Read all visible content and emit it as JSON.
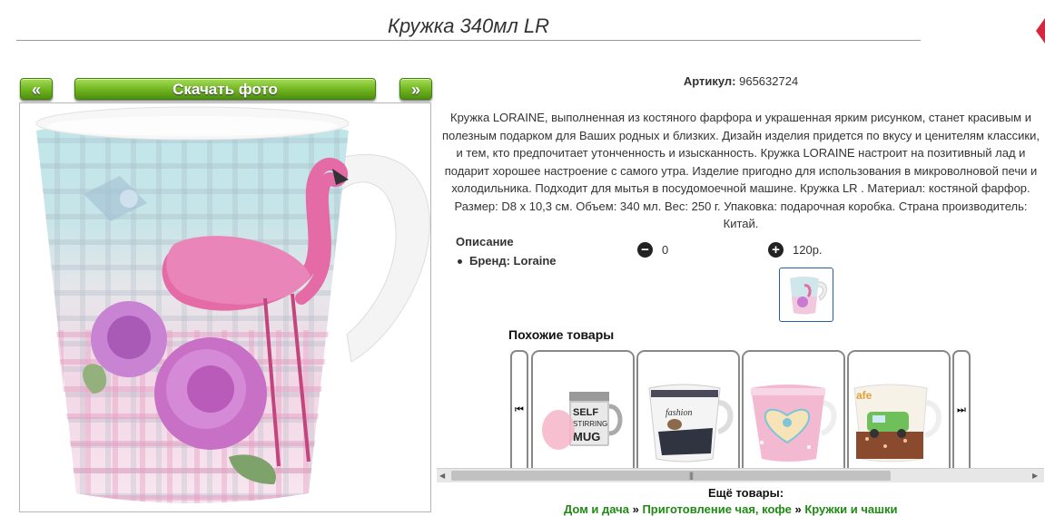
{
  "product": {
    "title": "Кружка 340мл LR",
    "sku_label": "Артикул:",
    "sku_value": "965632724",
    "description": "Кружка LORAINE, выполненная из костяного фарфора и украшенная ярким рисунком, станет красивым и полезным подарком для Ваших родных и близких. Дизайн изделия придется по вкусу и ценителям классики, и тем, кто предпочитает утонченность и изысканность. Кружка LORAINE настроит на позитивный лад и подарит хорошее настроение с самого утра. Изделие пригодно для использования в микроволновой печи и холодильника. Подходит для мытья в посудомоечной машине. Кружка LR . Материал: костяной фарфор. Размер: D8 х 10,3 см. Объем: 340 мл. Вес: 250 г. Упаковка: подарочная коробка. Страна производитель: Китай."
  },
  "gallery": {
    "prev_label": "«",
    "download_label": "Скачать фото",
    "next_label": "»",
    "photo_icon": "flamingo-rose-mug-photo"
  },
  "specs": {
    "heading": "Описание",
    "brand": "Бренд: Loraine"
  },
  "counters": {
    "minus_icon": "minus-circle-icon",
    "minus_value": "0",
    "plus_icon": "plus-circle-icon",
    "plus_value": "120р."
  },
  "similar": {
    "heading": "Похожие товары",
    "prev_icon": "skip-prev-icon",
    "next_icon": "skip-next-icon",
    "items": [
      {
        "icon": "self-stirring-mug-image",
        "text": "SELF STIRRING MUG"
      },
      {
        "icon": "fashion-mug-image"
      },
      {
        "icon": "heart-mug-image"
      },
      {
        "icon": "retro-car-mug-image"
      }
    ]
  },
  "more": {
    "heading": "Ещё товары:",
    "crumbs": [
      "Дом и дача",
      "Приготовление чая, кофе",
      "Кружки и чашки"
    ],
    "sep": "»"
  },
  "colors": {
    "button_green": "#6fb41e",
    "link_green": "#1f8a14",
    "thumb_border": "#2a5d9f"
  }
}
